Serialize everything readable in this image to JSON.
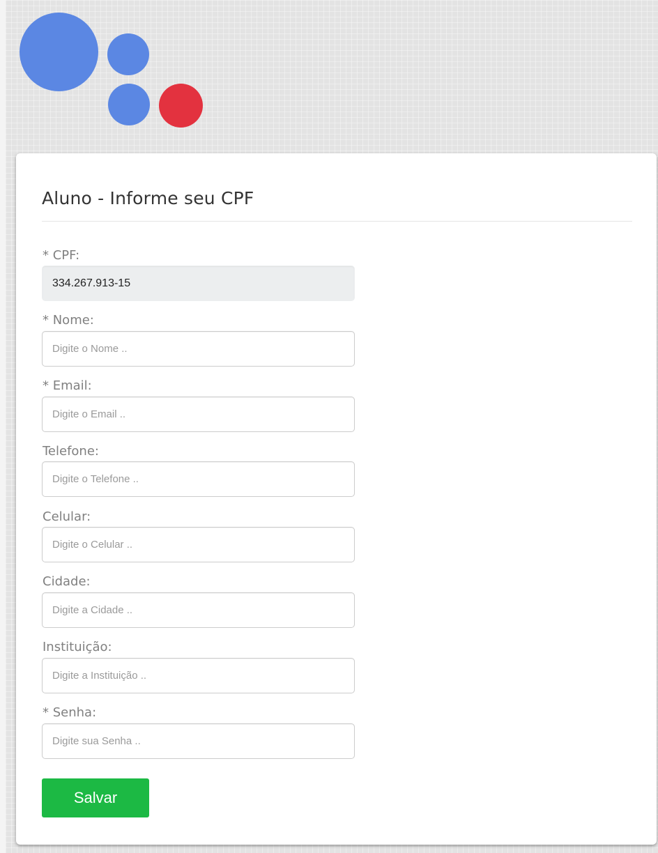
{
  "logo": {
    "dots": {
      "big_color": "#5b87e3",
      "top_color": "#5b87e3",
      "bottom_color": "#5b87e3",
      "accent_color": "#e3323f"
    }
  },
  "form": {
    "title": "Aluno - Informe seu CPF",
    "fields": {
      "cpf": {
        "label": "* CPF:",
        "value": "334.267.913-15",
        "placeholder": ""
      },
      "nome": {
        "label": "* Nome:",
        "value": "",
        "placeholder": "Digite o Nome .."
      },
      "email": {
        "label": "* Email:",
        "value": "",
        "placeholder": "Digite o Email .."
      },
      "telefone": {
        "label": "Telefone:",
        "value": "",
        "placeholder": "Digite o Telefone .."
      },
      "celular": {
        "label": "Celular:",
        "value": "",
        "placeholder": "Digite o Celular .."
      },
      "cidade": {
        "label": "Cidade:",
        "value": "",
        "placeholder": "Digite a Cidade .."
      },
      "instituicao": {
        "label": "Instituição:",
        "value": "",
        "placeholder": "Digite a Instituição .."
      },
      "senha": {
        "label": "* Senha:",
        "value": "",
        "placeholder": "Digite sua Senha .."
      }
    },
    "submit_label": "Salvar"
  }
}
